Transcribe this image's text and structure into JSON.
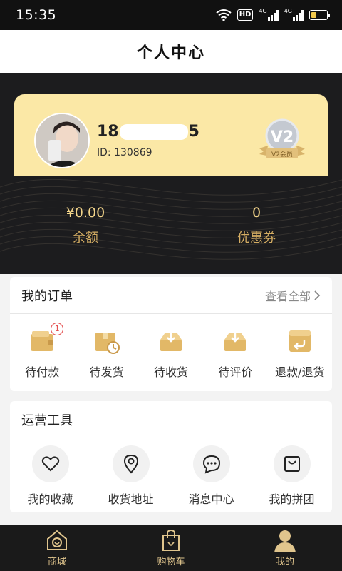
{
  "status_bar": {
    "time": "15:35",
    "hd_label": "HD",
    "network_label": "4G",
    "network_label_2": "4G",
    "icons": [
      "wifi-icon",
      "hd-icon",
      "signal-4g-icon",
      "signal-4g-icon",
      "battery-icon"
    ]
  },
  "header": {
    "title": "个人中心"
  },
  "profile": {
    "phone_prefix": "18",
    "phone_suffix": "5",
    "id_text": "ID: 130869",
    "vip_level": "V2",
    "vip_label": "V2会员"
  },
  "stats": {
    "balance_value": "¥0.00",
    "balance_label": "余额",
    "coupon_value": "0",
    "coupon_label": "优惠券"
  },
  "orders": {
    "title": "我的订单",
    "view_all": "查看全部",
    "items": [
      {
        "label": "待付款",
        "icon": "wallet-icon",
        "badge": "1"
      },
      {
        "label": "待发货",
        "icon": "pending-shipment-icon"
      },
      {
        "label": "待收货",
        "icon": "receive-box-icon"
      },
      {
        "label": "待评价",
        "icon": "review-box-icon"
      },
      {
        "label": "退款/退货",
        "icon": "refund-icon"
      }
    ]
  },
  "tools": {
    "title": "运营工具",
    "items": [
      {
        "label": "我的收藏",
        "icon": "heart-icon"
      },
      {
        "label": "收货地址",
        "icon": "location-icon"
      },
      {
        "label": "消息中心",
        "icon": "message-icon"
      },
      {
        "label": "我的拼团",
        "icon": "shopping-bag-icon"
      }
    ]
  },
  "tab_bar": {
    "items": [
      {
        "label": "商城",
        "icon": "home-icon"
      },
      {
        "label": "购物车",
        "icon": "cart-icon"
      },
      {
        "label": "我的",
        "icon": "user-icon",
        "active": true
      }
    ]
  },
  "colors": {
    "gold": "#d4ad63",
    "card": "#fbe8a6",
    "dark": "#1c1c1e",
    "badge_red": "#e34b4b"
  }
}
